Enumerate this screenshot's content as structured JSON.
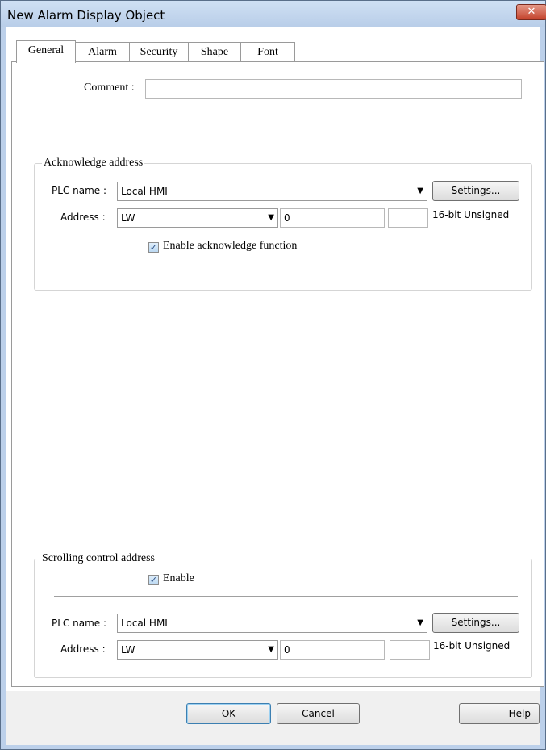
{
  "window": {
    "title": "New Alarm Display Object",
    "close_glyph": "✕"
  },
  "tabs": [
    {
      "label": "General",
      "active": true
    },
    {
      "label": "Alarm"
    },
    {
      "label": "Security"
    },
    {
      "label": "Shape"
    },
    {
      "label": "Font"
    }
  ],
  "general": {
    "comment_label": "Comment :",
    "comment_value": ""
  },
  "acknowledge": {
    "title": "Acknowledge address",
    "plc_label": "PLC name :",
    "plc_value": "Local HMI",
    "settings_label": "Settings...",
    "address_label": "Address :",
    "address_type": "LW",
    "address_value": "0",
    "address_extra": "",
    "data_format": "16-bit Unsigned",
    "enable_label": "Enable acknowledge function",
    "enable_checked": true
  },
  "scrolling": {
    "title": "Scrolling control address",
    "enable_label": "Enable",
    "enable_checked": true,
    "plc_label": "PLC name :",
    "plc_value": "Local HMI",
    "settings_label": "Settings...",
    "address_label": "Address :",
    "address_type": "LW",
    "address_value": "0",
    "address_extra": "",
    "data_format": "16-bit Unsigned"
  },
  "buttons": {
    "ok": "OK",
    "cancel": "Cancel",
    "help": "Help"
  },
  "icons": {
    "dropdown": "chevron-down-icon",
    "check": "check-icon",
    "close": "close-icon"
  }
}
